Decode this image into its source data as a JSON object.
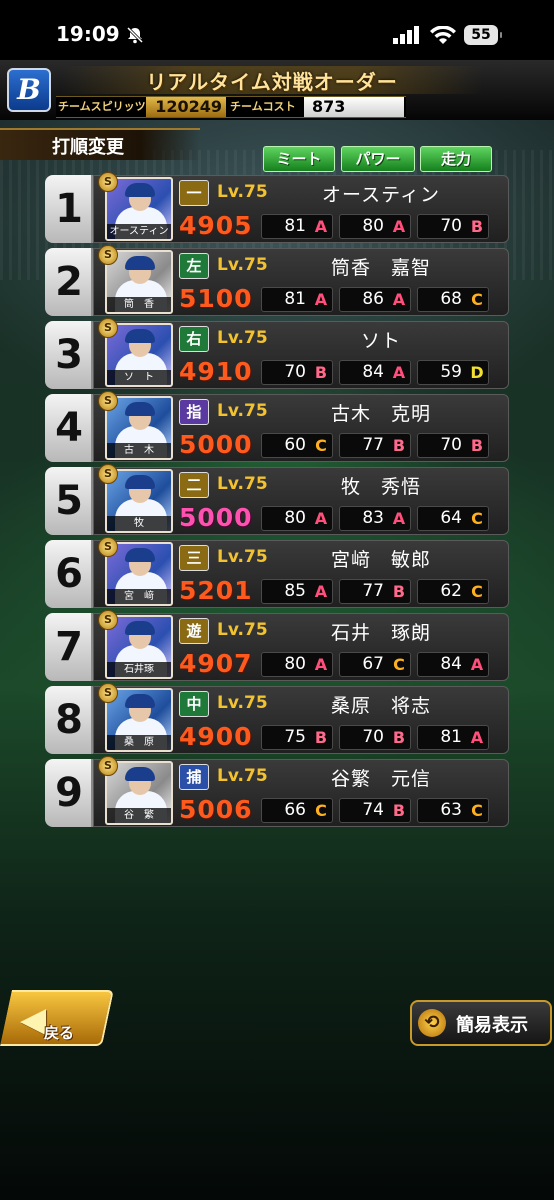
{
  "status_bar": {
    "time": "19:09",
    "battery": "55"
  },
  "header": {
    "title": "リアルタイム対戦オーダー",
    "team_spirits_label": "チームスピリッツ",
    "team_spirits_value": "120249",
    "team_cost_label": "チームコスト",
    "team_cost_value": "873"
  },
  "section_title": "打順変更",
  "stat_tabs": [
    "ミート",
    "パワー",
    "走力"
  ],
  "players": [
    {
      "order": "1",
      "card_name": "オースティン",
      "position": "一",
      "pos_color": "#8a6a12",
      "level": "Lv.75",
      "name": "オースティン",
      "overall": "4905",
      "overall_color": "orange",
      "stats": [
        {
          "v": "81",
          "g": "A"
        },
        {
          "v": "80",
          "g": "A"
        },
        {
          "v": "70",
          "g": "B"
        }
      ]
    },
    {
      "order": "2",
      "card_name": "筒　香",
      "position": "左",
      "pos_color": "#1f7a3a",
      "level": "Lv.75",
      "name": "筒香　嘉智",
      "overall": "5100",
      "overall_color": "orange",
      "stats": [
        {
          "v": "81",
          "g": "A"
        },
        {
          "v": "86",
          "g": "A"
        },
        {
          "v": "68",
          "g": "C"
        }
      ]
    },
    {
      "order": "3",
      "card_name": "ソ　ト",
      "position": "右",
      "pos_color": "#1f7a3a",
      "level": "Lv.75",
      "name": "ソト",
      "overall": "4910",
      "overall_color": "orange",
      "stats": [
        {
          "v": "70",
          "g": "B"
        },
        {
          "v": "84",
          "g": "A"
        },
        {
          "v": "59",
          "g": "D"
        }
      ]
    },
    {
      "order": "4",
      "card_name": "古　木",
      "position": "指",
      "pos_color": "#5a3aa0",
      "level": "Lv.75",
      "name": "古木　克明",
      "overall": "5000",
      "overall_color": "orange",
      "stats": [
        {
          "v": "60",
          "g": "C"
        },
        {
          "v": "77",
          "g": "B"
        },
        {
          "v": "70",
          "g": "B"
        }
      ]
    },
    {
      "order": "5",
      "card_name": "牧",
      "position": "二",
      "pos_color": "#8a6a12",
      "level": "Lv.75",
      "name": "牧　秀悟",
      "overall": "5000",
      "overall_color": "pink",
      "stats": [
        {
          "v": "80",
          "g": "A"
        },
        {
          "v": "83",
          "g": "A"
        },
        {
          "v": "64",
          "g": "C"
        }
      ]
    },
    {
      "order": "6",
      "card_name": "宮　﨑",
      "position": "三",
      "pos_color": "#8a6a12",
      "level": "Lv.75",
      "name": "宮﨑　敏郎",
      "overall": "5201",
      "overall_color": "orange",
      "stats": [
        {
          "v": "85",
          "g": "A"
        },
        {
          "v": "77",
          "g": "B"
        },
        {
          "v": "62",
          "g": "C"
        }
      ]
    },
    {
      "order": "7",
      "card_name": "石井琢",
      "position": "遊",
      "pos_color": "#8a6a12",
      "level": "Lv.75",
      "name": "石井　琢朗",
      "overall": "4907",
      "overall_color": "orange",
      "stats": [
        {
          "v": "80",
          "g": "A"
        },
        {
          "v": "67",
          "g": "C"
        },
        {
          "v": "84",
          "g": "A"
        }
      ]
    },
    {
      "order": "8",
      "card_name": "桑　原",
      "position": "中",
      "pos_color": "#1f7a3a",
      "level": "Lv.75",
      "name": "桑原　将志",
      "overall": "4900",
      "overall_color": "orange",
      "stats": [
        {
          "v": "75",
          "g": "B"
        },
        {
          "v": "70",
          "g": "B"
        },
        {
          "v": "81",
          "g": "A"
        }
      ]
    },
    {
      "order": "9",
      "card_name": "谷　繁",
      "position": "捕",
      "pos_color": "#2a4fa8",
      "level": "Lv.75",
      "name": "谷繁　元信",
      "overall": "5006",
      "overall_color": "orange",
      "stats": [
        {
          "v": "66",
          "g": "C"
        },
        {
          "v": "74",
          "g": "B"
        },
        {
          "v": "63",
          "g": "C"
        }
      ]
    }
  ],
  "buttons": {
    "back": "戻る",
    "simple_view": "簡易表示"
  }
}
